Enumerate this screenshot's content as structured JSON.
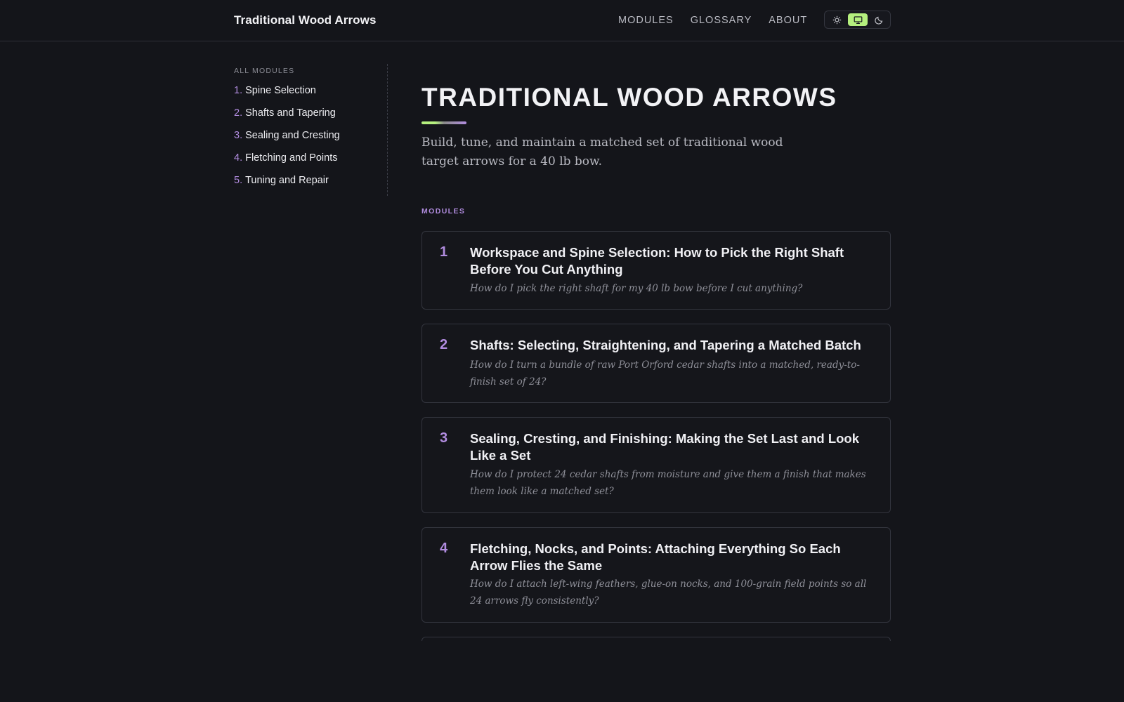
{
  "header": {
    "brand": "Traditional Wood Arrows",
    "nav": [
      "MODULES",
      "GLOSSARY",
      "ABOUT"
    ],
    "theme_options": [
      {
        "icon": "sun-icon",
        "active": false
      },
      {
        "icon": "monitor-icon",
        "active": true
      },
      {
        "icon": "moon-icon",
        "active": false
      }
    ],
    "accent": "#b5f07e"
  },
  "sidebar": {
    "heading": "ALL MODULES",
    "items": [
      {
        "num": "1.",
        "label": "Spine Selection"
      },
      {
        "num": "2.",
        "label": "Shafts and Tapering"
      },
      {
        "num": "3.",
        "label": "Sealing and Cresting"
      },
      {
        "num": "4.",
        "label": "Fletching and Points"
      },
      {
        "num": "5.",
        "label": "Tuning and Repair"
      }
    ]
  },
  "main": {
    "title": "TRADITIONAL WOOD ARROWS",
    "subtitle": "Build, tune, and maintain a matched set of traditional wood target arrows for a 40 lb bow.",
    "section_label": "MODULES",
    "modules": [
      {
        "num": "1",
        "title": "Workspace and Spine Selection: How to Pick the Right Shaft Before You Cut Anything",
        "desc": "How do I pick the right shaft for my 40 lb bow before I cut anything?"
      },
      {
        "num": "2",
        "title": "Shafts: Selecting, Straightening, and Tapering a Matched Batch",
        "desc": "How do I turn a bundle of raw Port Orford cedar shafts into a matched, ready-to-finish set of 24?"
      },
      {
        "num": "3",
        "title": "Sealing, Cresting, and Finishing: Making the Set Last and Look Like a Set",
        "desc": "How do I protect 24 cedar shafts from moisture and give them a finish that makes them look like a matched set?"
      },
      {
        "num": "4",
        "title": "Fletching, Nocks, and Points: Attaching Everything So Each Arrow Flies the Same",
        "desc": "How do I attach left-wing feathers, glue-on nocks, and 100-grain field points so all 24 arrows fly consistently?"
      }
    ],
    "number_color": "#b18cdf"
  }
}
